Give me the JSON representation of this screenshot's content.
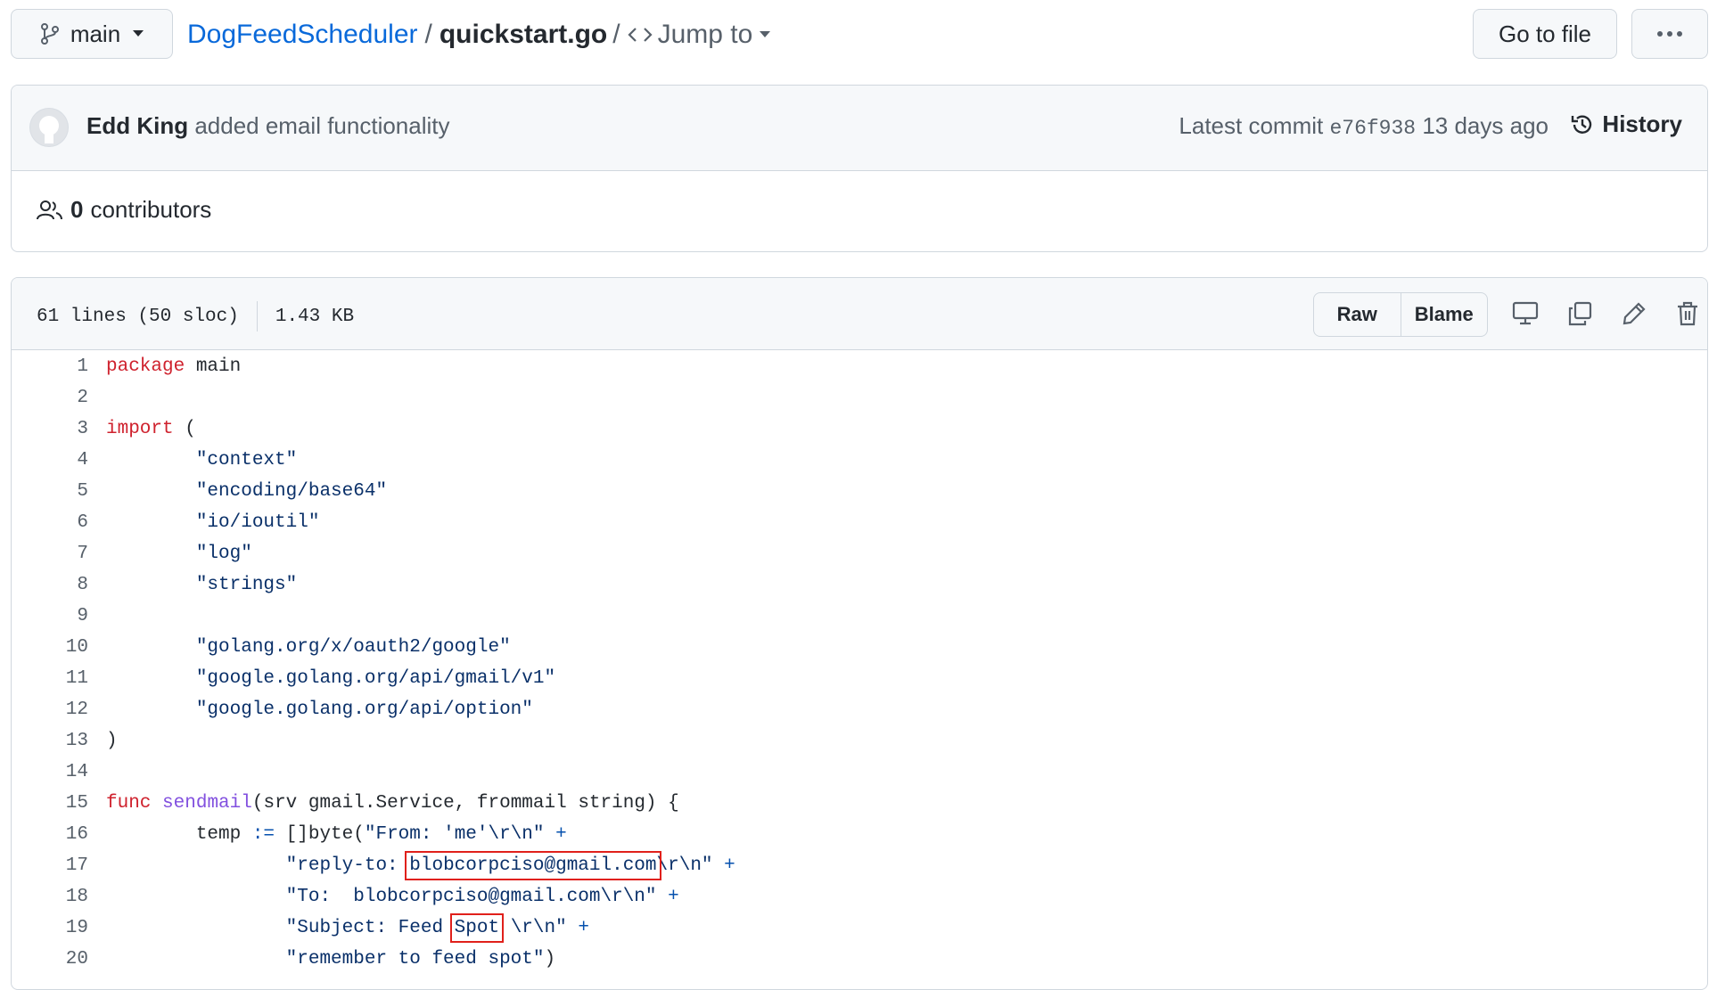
{
  "header": {
    "branch": "main",
    "repo": "DogFeedScheduler",
    "separator": "/",
    "file": "quickstart.go",
    "jump_sep": "/",
    "jump_label": "Jump to",
    "goto_file": "Go to file",
    "more_icon": "kebab-horizontal-icon"
  },
  "commit": {
    "author": "Edd King",
    "message": "added email functionality",
    "latest_label": "Latest commit",
    "sha": "e76f938",
    "age": "13 days ago",
    "history_label": "History"
  },
  "contributors": {
    "count": "0",
    "label": "contributors"
  },
  "file_info": {
    "lines": "61 lines (50 sloc)",
    "size": "1.43 KB",
    "raw": "Raw",
    "blame": "Blame",
    "icons": [
      "desktop-icon",
      "copy-icon",
      "pencil-icon",
      "trash-icon"
    ]
  },
  "highlight_color": "#e0201b",
  "code": {
    "lines": [
      "1",
      "2",
      "3",
      "4",
      "5",
      "6",
      "7",
      "8",
      "9",
      "10",
      "11",
      "12",
      "13",
      "14",
      "15",
      "16",
      "17",
      "18",
      "19",
      "20"
    ],
    "l1": {
      "kw": "package",
      "rest": " main"
    },
    "l3": {
      "kw": "import",
      "rest": " ("
    },
    "l4": "\t\"context\"",
    "l5": "\t\"encoding/base64\"",
    "l6": "\t\"io/ioutil\"",
    "l7": "\t\"log\"",
    "l8": "\t\"strings\"",
    "l10": "\t\"golang.org/x/oauth2/google\"",
    "l11": "\t\"google.golang.org/api/gmail/v1\"",
    "l12": "\t\"google.golang.org/api/option\"",
    "l13": ")",
    "l15": {
      "kw": "func",
      "fn": "sendmail",
      "rest": "(srv gmail.Service, frommail string) {"
    },
    "l16": {
      "a": "\ttemp ",
      "op1": ":=",
      "b": " []byte(",
      "s": "\"From: 'me'\\r\\n\"",
      "op2": " +"
    },
    "l17": {
      "a": "\t\t\"reply-to: ",
      "hl": "blobcorpciso@gmail.com",
      "b": "\\r\\n\"",
      "op": " +"
    },
    "l18": {
      "s": "\t\t\"To:  blobcorpciso@gmail.com\\r\\n\"",
      "op": " +"
    },
    "l19": {
      "a": "\t\t\"Subject: Feed ",
      "hl": "Spot",
      "b": " \\r\\n\"",
      "op": " +"
    },
    "l20": {
      "s": "\t\t\"remember to feed spot\"",
      "rest": ")"
    }
  }
}
